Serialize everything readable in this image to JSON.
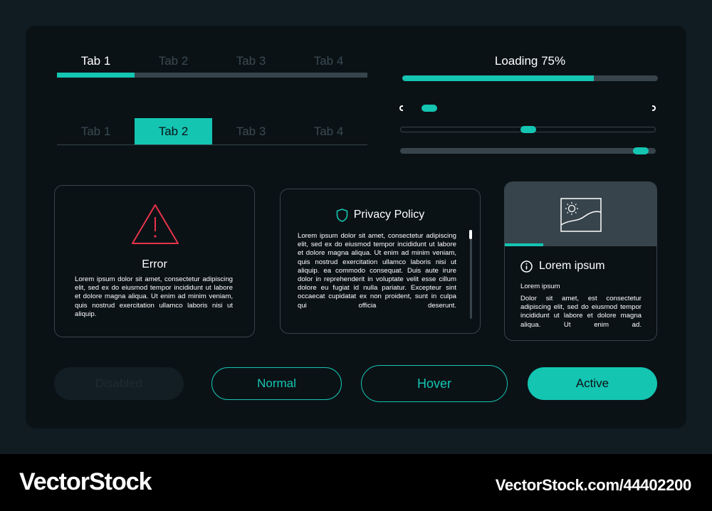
{
  "colors": {
    "accent": "#14c5b2",
    "error": "#e8334a",
    "muted": "#37444b",
    "panel": "#0b1216",
    "background": "#111b22"
  },
  "tabs_row1": {
    "tabs": [
      "Tab 1",
      "Tab 2",
      "Tab 3",
      "Tab 4"
    ],
    "active_index": 0
  },
  "tabs_row2": {
    "tabs": [
      "Tab 1",
      "Tab 2",
      "Tab 3",
      "Tab 4"
    ],
    "active_index": 1
  },
  "loading": {
    "label": "Loading 75%",
    "progress": 0.75
  },
  "sliders": [
    {
      "value": 0.09
    },
    {
      "value": 0.5
    },
    {
      "value": 0.97
    }
  ],
  "error_card": {
    "icon": "warning-triangle-icon",
    "title": "Error",
    "text": "Lorem ipsum dolor sit amet, consectetur adipiscing elit, sed ex do eiusmod tempor incididunt ut labore et dolore magna aliqua. Ut enim ad minim veniam, quis nostrud exercitation ullamco laboris nisi ut aliquip."
  },
  "privacy_card": {
    "icon": "shield-icon",
    "title": "Privacy Policy",
    "text": "Lorem ipsum dolor sit amet, consectetur adipiscing elit, sed ex do eiusmod tempor incididunt ut labore et dolore magna aliqua. Ut enim ad minim veniam, quis nostrud exercitation ullamco laboris nisi ut aliquip. ea commodo consequat. Duis aute irure dolor in reprehenderit in voluptate velit esse cillum dolore eu fugiat id nulla pariatur. Excepteur sint occaecat cupidatat ex non proident, sunt in culpa qui officia deserunt."
  },
  "info_card": {
    "image_icon": "landscape-image-icon",
    "icon": "info-circle-icon",
    "title": "Lorem ipsum",
    "subtitle": "Lorem ipsum",
    "text": "Dolor sit amet, est consectetur adipiscing elit, sed do eiusmod tempor incididunt ut labore et dolore magna aliqua. Ut enim ad."
  },
  "buttons": {
    "disabled": "Disabled",
    "normal": "Normal",
    "hover": "Hover",
    "active": "Active"
  },
  "footer": {
    "brand": "VectorStock",
    "url": "VectorStock.com/44402200"
  }
}
